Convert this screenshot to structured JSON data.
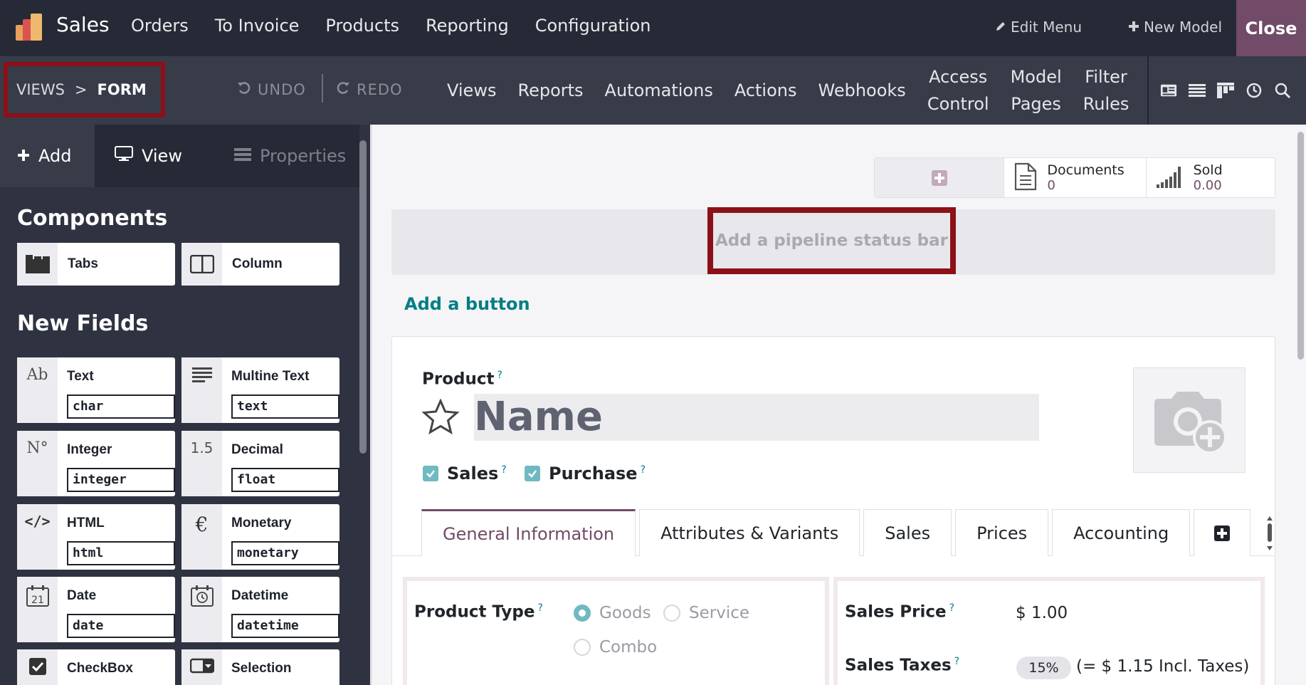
{
  "topbar": {
    "app_title": "Sales",
    "menu": [
      "Orders",
      "To Invoice",
      "Products",
      "Reporting",
      "Configuration"
    ],
    "edit_menu": "Edit Menu",
    "new_model": "New Model",
    "close": "Close"
  },
  "subbar": {
    "breadcrumb_views": "VIEWS",
    "breadcrumb_sep": ">",
    "breadcrumb_form": "FORM",
    "undo": "UNDO",
    "redo": "REDO",
    "nav": [
      "Views",
      "Reports",
      "Automations",
      "Actions",
      "Webhooks"
    ],
    "access_control_1": "Access",
    "access_control_2": "Control",
    "model_pages_1": "Model",
    "model_pages_2": "Pages",
    "filter_rules_1": "Filter",
    "filter_rules_2": "Rules"
  },
  "sidebar": {
    "tab_add": "Add",
    "tab_view": "View",
    "tab_properties": "Properties",
    "components_title": "Components",
    "components": [
      {
        "label": "Tabs",
        "icon": "tabs-icon"
      },
      {
        "label": "Column",
        "icon": "column-icon"
      }
    ],
    "new_fields_title": "New Fields",
    "fields": [
      {
        "label": "Text",
        "type": "char",
        "icon": "Ab"
      },
      {
        "label": "Multine Text",
        "type": "text",
        "icon": "lines-icon"
      },
      {
        "label": "Integer",
        "type": "integer",
        "icon": "N°"
      },
      {
        "label": "Decimal",
        "type": "float",
        "icon": "1.5"
      },
      {
        "label": "HTML",
        "type": "html",
        "icon": "</>"
      },
      {
        "label": "Monetary",
        "type": "monetary",
        "icon": "€"
      },
      {
        "label": "Date",
        "type": "date",
        "icon": "21"
      },
      {
        "label": "Datetime",
        "type": "datetime",
        "icon": "clock-icon"
      },
      {
        "label": "CheckBox",
        "type": "",
        "icon": "check-icon"
      },
      {
        "label": "Selection",
        "type": "",
        "icon": "select-icon"
      }
    ]
  },
  "form": {
    "smart_buttons": [
      {
        "title": "Documents",
        "value": "0"
      },
      {
        "title": "Sold",
        "value": "0.00"
      }
    ],
    "statusbar_label": "Add a pipeline status bar",
    "add_button_label": "Add a button",
    "product_label": "Product",
    "name_placeholder": "Name",
    "sales_label": "Sales",
    "purchase_label": "Purchase",
    "tabs": [
      "General Information",
      "Attributes & Variants",
      "Sales",
      "Prices",
      "Accounting"
    ],
    "product_type_label": "Product Type",
    "product_type_options": [
      "Goods",
      "Service",
      "Combo"
    ],
    "product_type_selected": "Goods",
    "sales_price_label": "Sales Price",
    "sales_price_value": "$ 1.00",
    "sales_taxes_label": "Sales Taxes",
    "sales_taxes_badge": "15%",
    "sales_taxes_incl": "(= $ 1.15 Incl. Taxes)",
    "q_mark": "?"
  },
  "colors": {
    "navbar": "#262a36",
    "subbar": "#383c49",
    "accent": "#714b67",
    "highlight": "#8c1018",
    "teal": "#017e84"
  }
}
